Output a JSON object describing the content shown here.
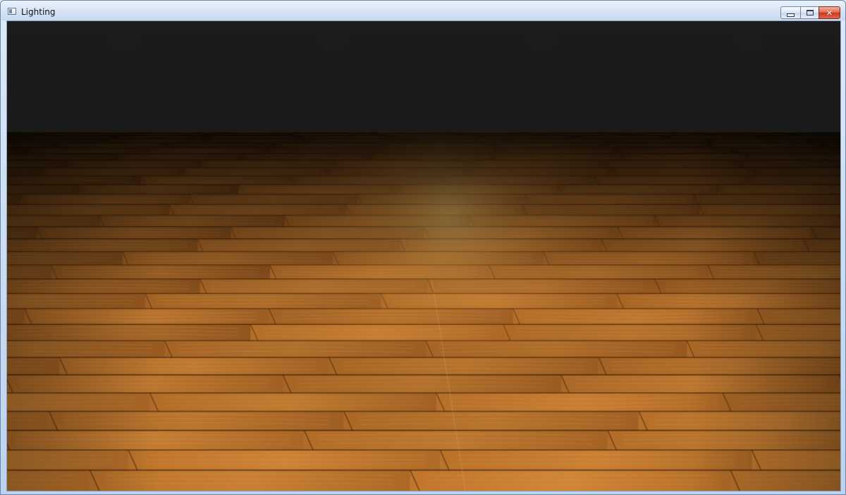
{
  "window": {
    "title": "Lighting",
    "icon": "app-window-icon",
    "controls": {
      "minimize_icon": "minimize-icon",
      "maximize_icon": "maximize-icon",
      "close_icon": "close-icon"
    }
  },
  "scene": {
    "background_color": "#1b1b1b",
    "floor_type": "wood parquet",
    "light_color": "#ffd27a"
  }
}
